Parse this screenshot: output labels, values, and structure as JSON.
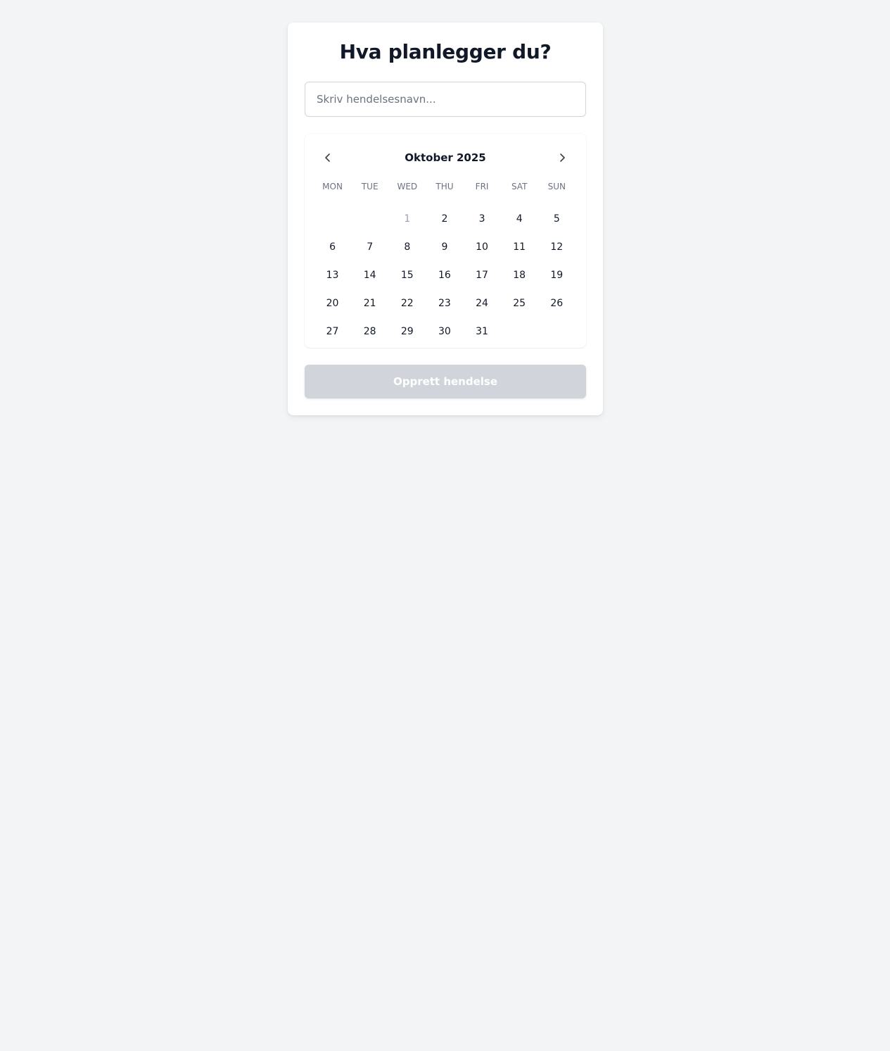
{
  "page": {
    "title": "Hva planlegger du?"
  },
  "event_name": {
    "value": "",
    "placeholder": "Skriv hendelsesnavn..."
  },
  "calendar": {
    "month_label": "Oktober 2025",
    "prev_icon": "chevron-left-icon",
    "next_icon": "chevron-right-icon",
    "weekdays": [
      "MON",
      "TUE",
      "WED",
      "THU",
      "FRI",
      "SAT",
      "SUN"
    ],
    "leading_blanks": 2,
    "days": [
      "1",
      "2",
      "3",
      "4",
      "5",
      "6",
      "7",
      "8",
      "9",
      "10",
      "11",
      "12",
      "13",
      "14",
      "15",
      "16",
      "17",
      "18",
      "19",
      "20",
      "21",
      "22",
      "23",
      "24",
      "25",
      "26",
      "27",
      "28",
      "29",
      "30",
      "31"
    ],
    "muted_days": [
      "1"
    ]
  },
  "actions": {
    "create_label": "Opprett hendelse",
    "create_disabled": true
  },
  "colors": {
    "background": "#f3f4f6",
    "card": "#ffffff",
    "text": "#111827",
    "muted_text": "#6b7280",
    "past_day": "#9ca3af",
    "disabled_button": "#d1d5db"
  }
}
